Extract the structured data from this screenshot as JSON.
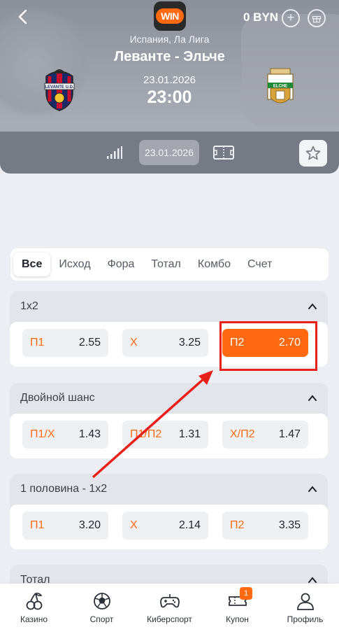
{
  "header": {
    "logo_text": "WIN",
    "balance": "0 BYN",
    "league": "Испания, Ла Лига",
    "match": "Леванте - Эльче",
    "date": "23.01.2026",
    "time": "23:00",
    "home_crest_text": "LEVANTE U.D.",
    "away_crest_text": "ELCHE"
  },
  "subbar": {
    "date": "23.01.2026"
  },
  "tabs": [
    {
      "label": "Все",
      "active": true
    },
    {
      "label": "Исход"
    },
    {
      "label": "Фора"
    },
    {
      "label": "Тотал"
    },
    {
      "label": "Комбо"
    },
    {
      "label": "Счет"
    }
  ],
  "markets": [
    {
      "title": "1x2",
      "odds": [
        {
          "k": "П1",
          "v": "2.55"
        },
        {
          "k": "Х",
          "v": "3.25"
        },
        {
          "k": "П2",
          "v": "2.70",
          "selected": true
        }
      ]
    },
    {
      "title": "Двойной шанс",
      "odds": [
        {
          "k": "П1/Х",
          "v": "1.43"
        },
        {
          "k": "П1/П2",
          "v": "1.31"
        },
        {
          "k": "Х/П2",
          "v": "1.47"
        }
      ]
    },
    {
      "title": "1 половина - 1x2",
      "odds": [
        {
          "k": "П1",
          "v": "3.20"
        },
        {
          "k": "Х",
          "v": "2.14"
        },
        {
          "k": "П2",
          "v": "3.35"
        }
      ]
    },
    {
      "title": "Тотал"
    }
  ],
  "nav": [
    {
      "label": "Казино",
      "icon": "cherries-icon"
    },
    {
      "label": "Спорт",
      "icon": "football-icon"
    },
    {
      "label": "Киберспорт",
      "icon": "gamepad-icon"
    },
    {
      "label": "Купон",
      "icon": "coupon-icon",
      "badge": "1"
    },
    {
      "label": "Профиль",
      "icon": "user-icon"
    }
  ],
  "colors": {
    "accent": "#ff6a10",
    "highlight": "#e8201a"
  }
}
